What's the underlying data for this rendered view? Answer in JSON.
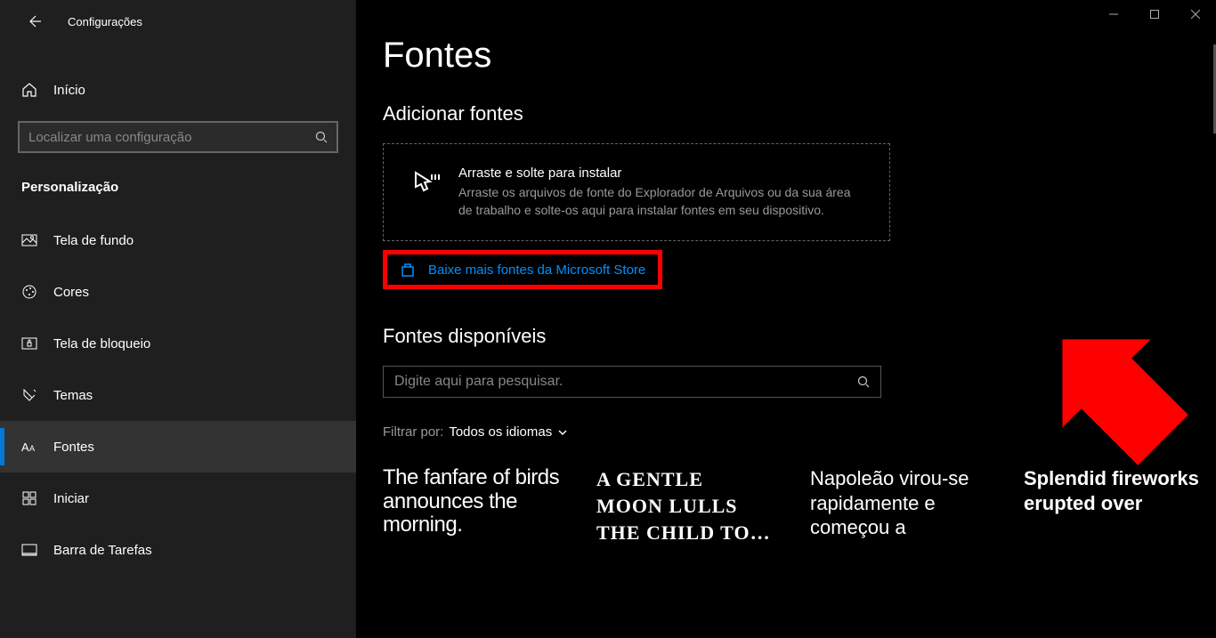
{
  "appTitle": "Configurações",
  "home": "Início",
  "searchPlaceholder": "Localizar uma configuração",
  "sectionHeader": "Personalização",
  "nav": [
    {
      "label": "Tela de fundo",
      "icon": "picture"
    },
    {
      "label": "Cores",
      "icon": "palette"
    },
    {
      "label": "Tela de bloqueio",
      "icon": "lock-screen"
    },
    {
      "label": "Temas",
      "icon": "themes"
    },
    {
      "label": "Fontes",
      "icon": "fonts",
      "active": true
    },
    {
      "label": "Iniciar",
      "icon": "start"
    },
    {
      "label": "Barra de Tarefas",
      "icon": "taskbar"
    }
  ],
  "pageTitle": "Fontes",
  "addFonts": {
    "title": "Adicionar fontes",
    "dropTitle": "Arraste e solte para instalar",
    "dropDesc": "Arraste os arquivos de fonte do Explorador de Arquivos ou da sua área de trabalho e solte-os aqui para instalar fontes em seu dispositivo.",
    "storeLink": "Baixe mais fontes da Microsoft Store"
  },
  "availableFonts": {
    "title": "Fontes disponíveis",
    "searchPlaceholder": "Digite aqui para pesquisar.",
    "filterLabel": "Filtrar por:",
    "filterValue": "Todos os idiomas"
  },
  "fontSamples": [
    "The fanfare of birds announces the morning.",
    "A gentle moon lulls the child to…",
    "Napoleão virou-se rapidamente e começou a",
    "Splendid fireworks erupted over"
  ]
}
